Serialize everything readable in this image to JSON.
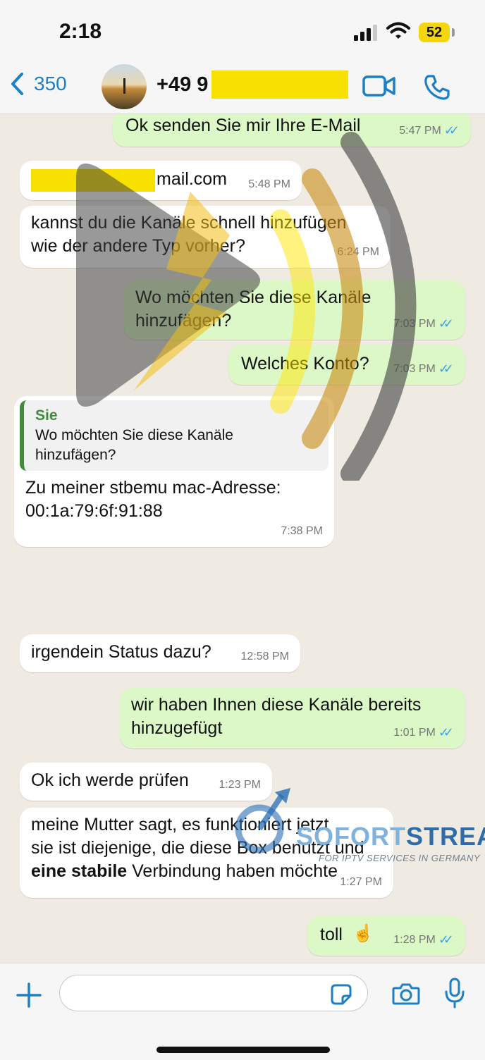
{
  "status": {
    "time": "2:18",
    "battery": "52"
  },
  "header": {
    "back_count": "350",
    "contact": "+49 9"
  },
  "messages": [
    {
      "id": "m1",
      "dir": "out",
      "text": "Ok senden Sie mir Ihre E-Mail",
      "time": "5:47 PM"
    },
    {
      "id": "m2",
      "dir": "in",
      "text": "mail.com",
      "time": "5:48 PM"
    },
    {
      "id": "m3",
      "dir": "in",
      "line1": "kannst du die Kanäle schnell hinzufügen",
      "line2": "wie der andere Typ vorher?",
      "time": "6:24 PM"
    },
    {
      "id": "m4",
      "dir": "out",
      "line1": "Wo möchten Sie diese Kanäle",
      "line2": "hinzufägen?",
      "time": "7:03 PM"
    },
    {
      "id": "m5",
      "dir": "out",
      "text": "Welches Konto?",
      "time": "7:03 PM"
    },
    {
      "id": "m6",
      "dir": "in",
      "quote_name": "Sie",
      "quote_line1": "Wo möchten Sie diese Kanäle",
      "quote_line2": "hinzufägen?",
      "line1": "Zu meiner stbemu mac-Adresse:",
      "line2": "00:1a:79:6f:91:88",
      "time": "7:38 PM"
    },
    {
      "id": "m7",
      "dir": "in",
      "text": "irgendein Status dazu?",
      "time": "12:58 PM"
    },
    {
      "id": "m8",
      "dir": "out",
      "line1": "wir haben Ihnen diese Kanäle bereits",
      "line2": "hinzugefügt",
      "time": "1:01 PM"
    },
    {
      "id": "m9",
      "dir": "in",
      "text": "Ok ich werde prüfen",
      "time": "1:23 PM"
    },
    {
      "id": "m10",
      "dir": "in",
      "line1": "meine Mutter sagt, es funktioniert jetzt",
      "line2": "sie ist diejenige, die diese Box benutzt und",
      "line3_bold": "eine stabile",
      "line3_rest": " Verbindung haben möchte",
      "time": "1:27 PM"
    },
    {
      "id": "m11",
      "dir": "out",
      "text": "toll",
      "emoji": "☝️",
      "time": "1:28 PM"
    }
  ],
  "watermark": {
    "brand_a": "SOFORT",
    "brand_b": "STREAM",
    "tagline": "FOR IPTV SERVICES IN GERMANY"
  },
  "colors": {
    "in_bubble": "#ffffff",
    "out_bubble": "#dcf8c6",
    "read_ticks": "#3aa6e6",
    "accent": "#1d7fc4",
    "redaction": "#f8e101"
  },
  "icons": [
    "back-chevron-icon",
    "video-call-icon",
    "phone-icon",
    "plus-icon",
    "sticker-icon",
    "camera-icon",
    "microphone-icon",
    "read-ticks-icon"
  ]
}
